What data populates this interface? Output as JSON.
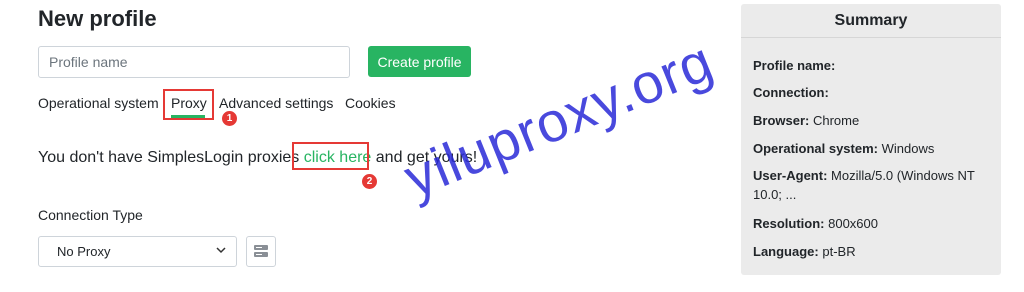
{
  "page": {
    "title": "New profile"
  },
  "profile_form": {
    "name_placeholder": "Profile name",
    "name_value": "",
    "create_button": "Create profile"
  },
  "tabs": [
    {
      "label": "Operational system",
      "active": false
    },
    {
      "label": "Proxy",
      "active": true
    },
    {
      "label": "Advanced settings",
      "active": false
    },
    {
      "label": "Cookies",
      "active": false
    }
  ],
  "proxy_notice": {
    "prefix": "You don't have SimplesLogin proxies ",
    "link": "click here",
    "suffix": " and get yours!"
  },
  "connection": {
    "label": "Connection Type",
    "selected": "No Proxy",
    "chevron_icon": "chevron-down-icon",
    "server_icon": "server-icon"
  },
  "annotations": [
    {
      "number": "1"
    },
    {
      "number": "2"
    }
  ],
  "watermark": "yiluproxy.org",
  "summary": {
    "title": "Summary",
    "rows": [
      {
        "key": "Profile name:",
        "value": ""
      },
      {
        "key": "Connection:",
        "value": ""
      },
      {
        "key": "Browser:",
        "value": " Chrome"
      },
      {
        "key": "Operational system:",
        "value": " Windows"
      },
      {
        "key": "User-Agent:",
        "value": " Mozilla/5.0 (Windows NT 10.0; ..."
      },
      {
        "key": "Resolution:",
        "value": " 800x600"
      },
      {
        "key": "Language:",
        "value": " pt-BR"
      }
    ]
  },
  "colors": {
    "accent": "#28b462",
    "annotation": "#e53935",
    "watermark": "#2a2ad8",
    "summary_bg": "#ebebeb"
  }
}
